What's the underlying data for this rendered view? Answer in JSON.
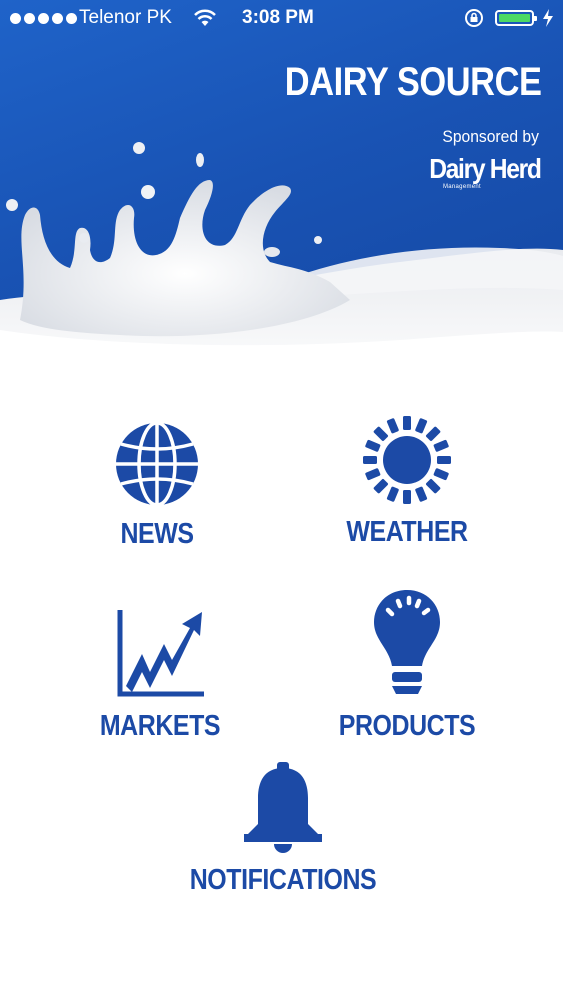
{
  "status_bar": {
    "carrier": "Telenor PK",
    "time": "3:08 PM",
    "battery_color": "#4cd964"
  },
  "header": {
    "title": "DAIRY SOURCE",
    "sponsored_label": "Sponsored by",
    "sponsor_name": "Dairy Herd",
    "sponsor_tagline": "Management"
  },
  "colors": {
    "brand_blue": "#1c4aa6",
    "header_blue": "#1953b4"
  },
  "menu": {
    "news": {
      "label": "NEWS",
      "icon": "globe-icon"
    },
    "weather": {
      "label": "WEATHER",
      "icon": "sun-icon"
    },
    "markets": {
      "label": "MARKETS",
      "icon": "chart-trend-icon"
    },
    "products": {
      "label": "PRODUCTS",
      "icon": "lightbulb-icon"
    },
    "notifications": {
      "label": "NOTIFICATIONS",
      "icon": "bell-icon"
    }
  }
}
